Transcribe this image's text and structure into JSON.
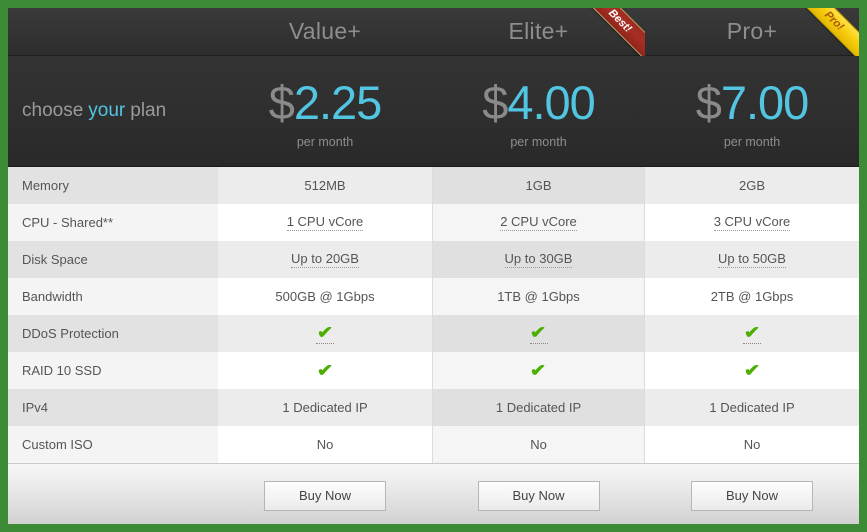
{
  "accent": {
    "green_border": "#3d8b37",
    "price_cyan": "#52c5e0",
    "check_green": "#4caf00",
    "ribbon_best": "#a82e24",
    "ribbon_pro": "#f7cf0e"
  },
  "header": {
    "tagline_pre": "choose",
    "tagline_mid": "your",
    "tagline_post": "plan",
    "per_month": "per month"
  },
  "plans": [
    {
      "name": "Value+",
      "currency": "$",
      "price": "2.25",
      "period": "per month",
      "ribbon": null,
      "buy_label": "Buy Now"
    },
    {
      "name": "Elite+",
      "currency": "$",
      "price": "4.00",
      "period": "per month",
      "ribbon": "Best!",
      "buy_label": "Buy Now"
    },
    {
      "name": "Pro+",
      "currency": "$",
      "price": "7.00",
      "period": "per month",
      "ribbon": "Pro!",
      "buy_label": "Buy Now"
    }
  ],
  "features": [
    {
      "label": "Memory",
      "values": [
        "512MB",
        "1GB",
        "2GB"
      ],
      "tooltip": false,
      "check": false
    },
    {
      "label": "CPU - Shared**",
      "values": [
        "1 CPU vCore",
        "2 CPU vCore",
        "3 CPU vCore"
      ],
      "tooltip": true,
      "check": false
    },
    {
      "label": "Disk Space",
      "values": [
        "Up to 20GB",
        "Up to 30GB",
        "Up to 50GB"
      ],
      "tooltip": true,
      "check": false
    },
    {
      "label": "Bandwidth",
      "values": [
        "500GB @ 1Gbps",
        "1TB @ 1Gbps",
        "2TB @ 1Gbps"
      ],
      "tooltip": false,
      "check": false
    },
    {
      "label": "DDoS Protection",
      "values": [
        "✔",
        "✔",
        "✔"
      ],
      "tooltip": true,
      "check": true
    },
    {
      "label": "RAID 10 SSD",
      "values": [
        "✔",
        "✔",
        "✔"
      ],
      "tooltip": false,
      "check": true
    },
    {
      "label": "IPv4",
      "values": [
        "1 Dedicated IP",
        "1 Dedicated IP",
        "1 Dedicated IP"
      ],
      "tooltip": false,
      "check": false
    },
    {
      "label": "Custom ISO",
      "values": [
        "No",
        "No",
        "No"
      ],
      "tooltip": false,
      "check": false
    }
  ]
}
